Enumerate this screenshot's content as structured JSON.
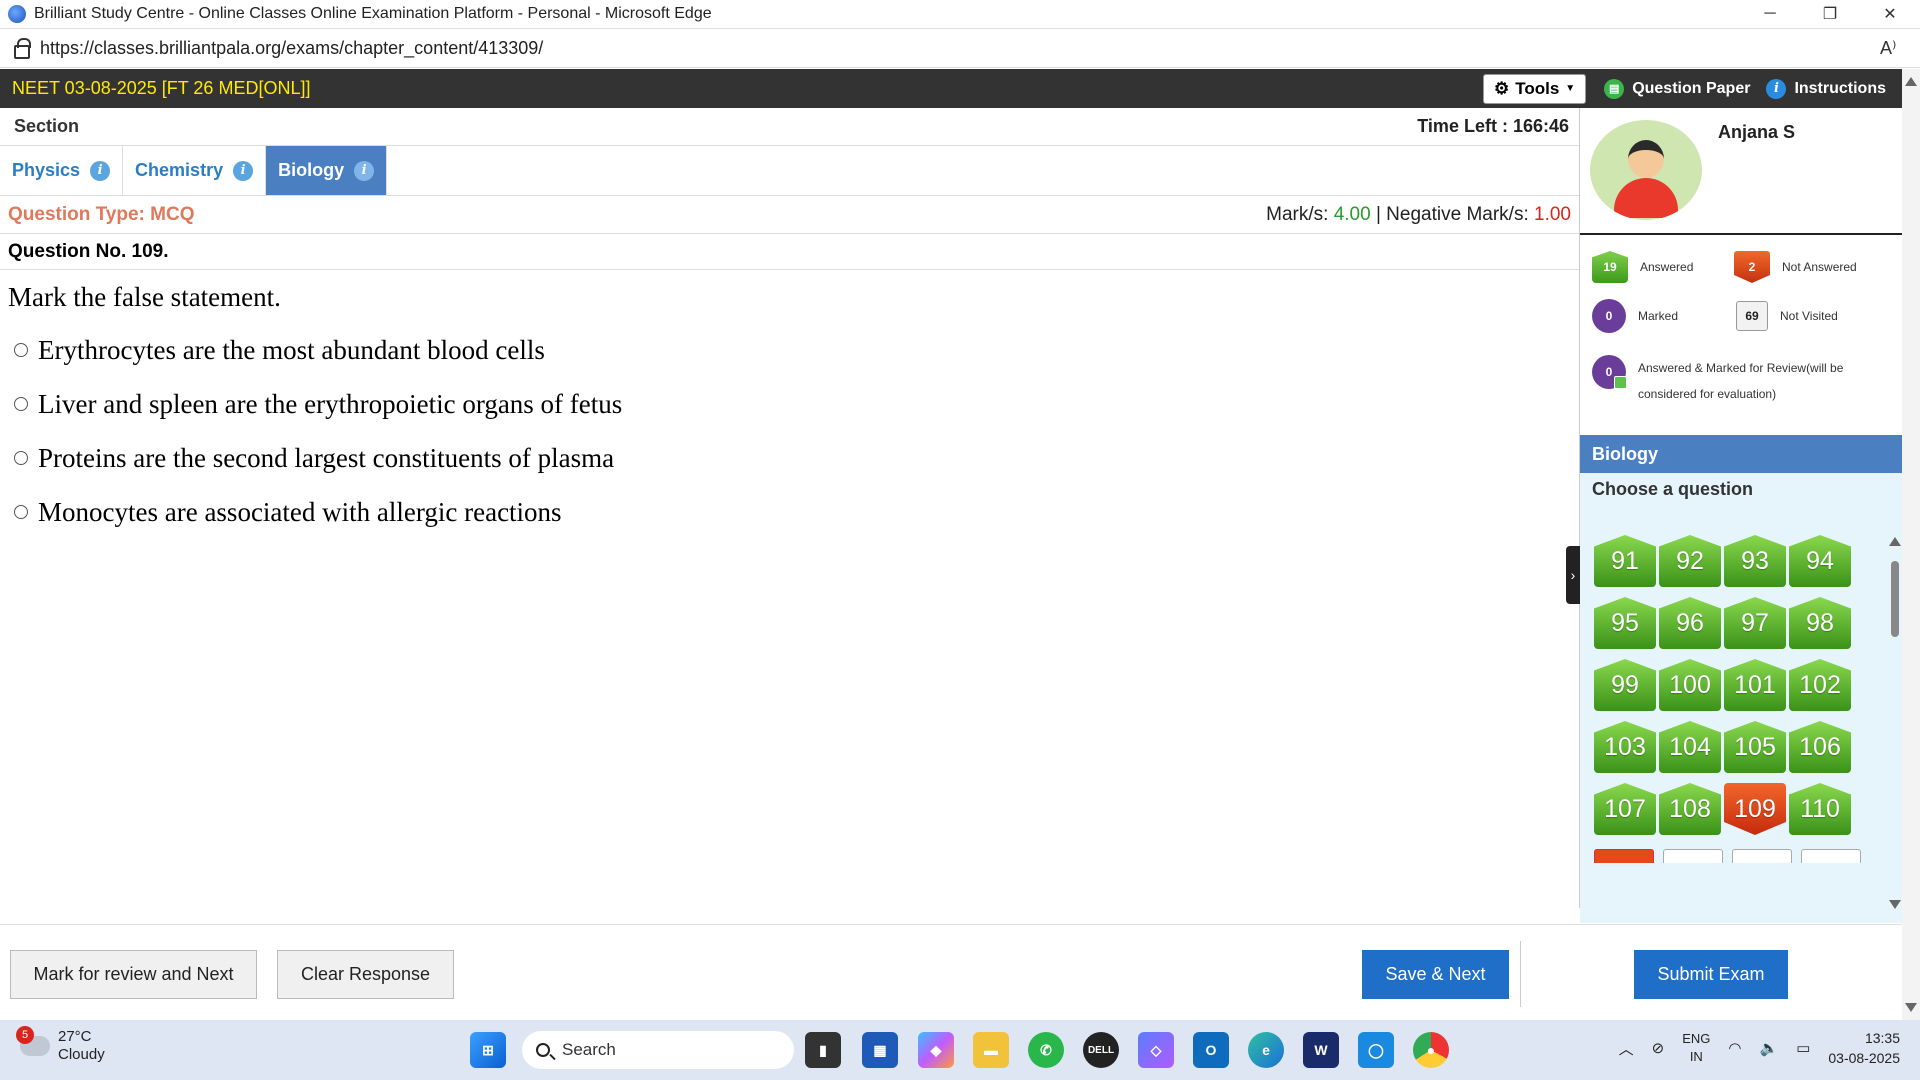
{
  "browser": {
    "title": "Brilliant Study Centre - Online Classes Online Examination Platform - Personal - Microsoft Edge",
    "url": "https://classes.brilliantpala.org/exams/chapter_content/413309/",
    "minimize": "─",
    "maximize": "❐",
    "close": "✕",
    "read_aloud": "A⁾"
  },
  "header": {
    "exam_title": "NEET 03-08-2025 [FT 26 MED[ONL]]",
    "tools_label": "Tools",
    "question_paper_label": "Question Paper",
    "instructions_label": "Instructions"
  },
  "section": {
    "label": "Section",
    "time_left": "Time Left : 166:46"
  },
  "tabs": [
    {
      "label": "Physics",
      "active": false
    },
    {
      "label": "Chemistry",
      "active": false
    },
    {
      "label": "Biology",
      "active": true
    }
  ],
  "question": {
    "type": "Question Type: MCQ",
    "marks_label": "Mark/s: ",
    "marks_value": "4.00",
    "neg_label": " | Negative Mark/s: ",
    "neg_value": "1.00",
    "number": "Question No. 109.",
    "text": "Mark the false statement.",
    "options": [
      "Erythrocytes are the most abundant blood cells",
      "Liver and spleen are the erythropoietic organs of fetus",
      "Proteins are the second largest constituents of plasma",
      "Monocytes are associated with allergic reactions"
    ]
  },
  "profile": {
    "name": "Anjana S"
  },
  "legend": {
    "answered_count": "19",
    "answered_label": "Answered",
    "not_answered_count": "2",
    "not_answered_label": "Not Answered",
    "marked_count": "0",
    "marked_label": "Marked",
    "not_visited_count": "69",
    "not_visited_label": "Not Visited",
    "amr_count": "0",
    "amr_label_1": "Answered & Marked for Review(will be",
    "amr_label_2": "considered for evaluation)"
  },
  "palette": {
    "section_name": "Biology",
    "choose_label": "Choose a question",
    "questions": [
      {
        "n": "91",
        "status": "answered"
      },
      {
        "n": "92",
        "status": "answered"
      },
      {
        "n": "93",
        "status": "answered"
      },
      {
        "n": "94",
        "status": "answered"
      },
      {
        "n": "95",
        "status": "answered"
      },
      {
        "n": "96",
        "status": "answered"
      },
      {
        "n": "97",
        "status": "answered"
      },
      {
        "n": "98",
        "status": "answered"
      },
      {
        "n": "99",
        "status": "answered"
      },
      {
        "n": "100",
        "status": "answered"
      },
      {
        "n": "101",
        "status": "answered"
      },
      {
        "n": "102",
        "status": "answered"
      },
      {
        "n": "103",
        "status": "answered"
      },
      {
        "n": "104",
        "status": "answered"
      },
      {
        "n": "105",
        "status": "answered"
      },
      {
        "n": "106",
        "status": "answered"
      },
      {
        "n": "107",
        "status": "answered"
      },
      {
        "n": "108",
        "status": "answered"
      },
      {
        "n": "109",
        "status": "not-answered"
      },
      {
        "n": "110",
        "status": "answered"
      }
    ]
  },
  "actions": {
    "mark_review": "Mark for review and Next",
    "clear": "Clear Response",
    "save_next": "Save & Next",
    "submit": "Submit Exam"
  },
  "taskbar": {
    "weather_badge": "5",
    "temperature": "27°C",
    "condition": "Cloudy",
    "search_label": "Search",
    "lang_1": "ENG",
    "lang_2": "IN",
    "time": "13:35",
    "date": "03-08-2025"
  },
  "colors": {
    "answered": "#3d9a1c",
    "not_answered": "#d9361a",
    "accent_blue": "#4a7fc1",
    "header_bg": "#333333",
    "exam_title": "#ffea00"
  }
}
